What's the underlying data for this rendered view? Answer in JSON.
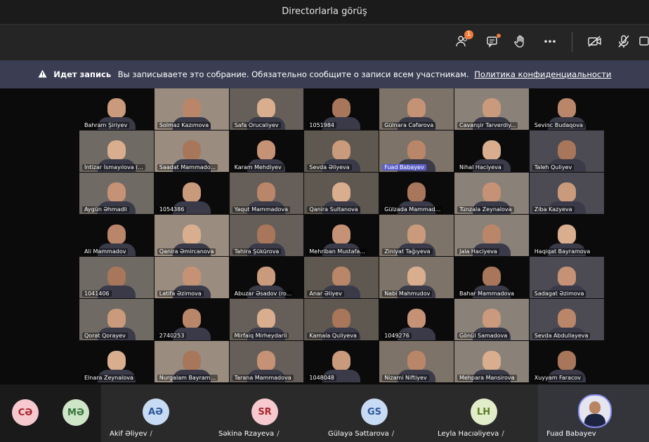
{
  "meeting_title": "Directorlarla görüş",
  "toolbar": {
    "participants_count": "1",
    "icons": [
      "participants-icon",
      "chat-icon",
      "raise-hand-icon",
      "more-icon",
      "camera-off-icon",
      "mic-off-icon",
      "share-icon"
    ]
  },
  "banner": {
    "title": "Идет запись",
    "message": "Вы записываете это собрание. Обязательно сообщите о записи всем участникам.",
    "link": "Политика конфиденциальности"
  },
  "grid_participants": [
    "Bahram Şiriyev",
    "Solmaz Kazımova",
    "Safa Orucaliyev",
    "1051984",
    "Gülnara Cəfərova",
    "Cavanşir Tarverdiy...",
    "Sevinc Budaqova",
    "İntizar İsmayılova (...",
    "Saadat Mammado...",
    "Karam Mehdiyev",
    "Sevda Əliyeva",
    "Fuad Babayev",
    "Nihal Haciyeva",
    "Taleh Quliyev",
    "Aygün Əhmadli",
    "1054386",
    "Yaqut Mammadova",
    "Qanira Sultanova",
    "Gülzada Mammad...",
    "Tünzala Zeynalova",
    "Ziba Kazyeva",
    "Ali Mammadov",
    "Qanira Əmircanova",
    "Tahira Şükürova",
    "Mehriban Mustafa...",
    "Ziniyat Tağıyeva",
    "Jala Haciyeva",
    "Haqiqat Bayramova",
    "1041406",
    "Latifa Əzimova",
    "Abuzar Əsadov (ro...",
    "Anar Əliyev",
    "Nabi Mahmudov",
    "Bahar Mammadova",
    "Sadagat Əzimova",
    "Qorat Qorayev",
    "2740253",
    "Mirfaiq Mirheydarli",
    "Kamala Quliyeva",
    "1049276",
    "Gönül Samadova",
    "Sevda Abdullayeva",
    "Elnara Zeynalova",
    "Nurgalam Bayram...",
    "Tarana Mammadova",
    "1048048",
    "Nizami Niftiyev",
    "Mehpara Mansirova",
    "Xuyyam Faracov"
  ],
  "highlighted_participant": "Fuad Babayev",
  "bottom_participants": [
    {
      "initials": "CƏ",
      "name": "",
      "bg": "#f6c9cf",
      "fg": "#a4262c"
    },
    {
      "initials": "MƏ",
      "name": "",
      "bg": "#cfe5c7",
      "fg": "#38753c"
    },
    {
      "initials": "AƏ",
      "name": "Akif Əliyev",
      "bg": "#c8dbf4",
      "fg": "#2a5798"
    },
    {
      "initials": "SR",
      "name": "Səkinə Rzayeva",
      "bg": "#f6c9cf",
      "fg": "#a4262c"
    },
    {
      "initials": "GS",
      "name": "Gülayə Səttarova",
      "bg": "#c8dbf4",
      "fg": "#2a5798"
    },
    {
      "initials": "LH",
      "name": "Leyla Hacıəliyeva",
      "bg": "#e1edc8",
      "fg": "#5b7d23"
    },
    {
      "initials": "",
      "name": "Fuad Babayev",
      "bg": "",
      "fg": ""
    }
  ]
}
